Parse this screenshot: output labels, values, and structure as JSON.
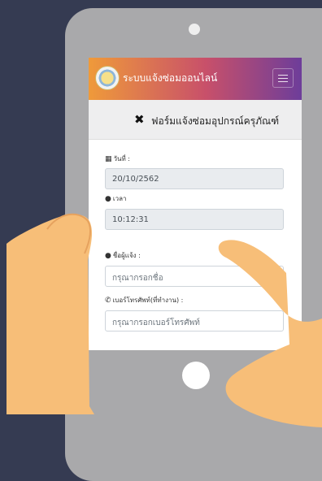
{
  "app": {
    "title": "ระบบแจ้งซ่อมออนไลน์"
  },
  "form": {
    "title": "ฟอร์มแจ้งซ่อมอุปกรณ์ครุภัณฑ์"
  },
  "fields": {
    "date": {
      "label": "วันที่ :",
      "value": "20/10/2562"
    },
    "time": {
      "label": "เวลา",
      "value": "10:12:31"
    },
    "name": {
      "label": "ชื่อผู้แจ้ง :",
      "placeholder": "กรุณากรอกชื่อ"
    },
    "phone": {
      "label": "เบอร์โทรศัพท์(ที่ทำงาน) :",
      "placeholder": "กรุณากรอกเบอร์โทรศัพท์"
    }
  },
  "icons": {
    "calendar": "calendar-icon",
    "clock": "user-clock-icon",
    "user": "user-icon",
    "phone": "phone-icon",
    "tools": "tools-icon",
    "menu": "hamburger-menu-icon"
  },
  "colors": {
    "navbar_start": "#ef9a3a",
    "navbar_end": "#6d3d9a",
    "background": "#353b52",
    "tablet": "#a9a9ab",
    "skin": "#f7be78"
  }
}
